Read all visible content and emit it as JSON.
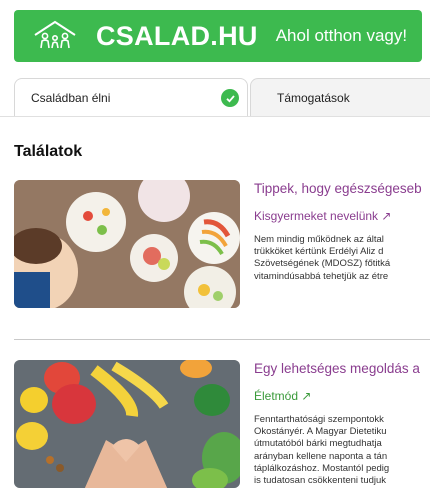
{
  "header": {
    "brand": "CSALAD.HU",
    "tagline": "Ahol otthon vagy!",
    "logo_icon": "family-house-icon",
    "brand_color": "#3dba4f"
  },
  "tabs": [
    {
      "label": "Családban élni",
      "active": true,
      "icon": "check-circle-icon"
    },
    {
      "label": "Támogatások",
      "active": false
    }
  ],
  "results": {
    "heading": "Találatok",
    "items": [
      {
        "title": "Tippek, hogy egészségeseb",
        "category": "Kisgyermeket nevelünk ↗",
        "category_color": "#8a3d8f",
        "excerpt": [
          "Nem mindig működnek az által",
          "trükköket kértünk Erdélyi Aliz d",
          "Szövetségének (MDOSZ) főtitká",
          "vitamindúsabbá tehetjük az étre"
        ]
      },
      {
        "title": "Egy lehetséges megoldás a",
        "category": "Életmód ↗",
        "category_color": "#3a9a3a",
        "excerpt": [
          "Fenntarthatósági szempontokk",
          "Okostányér. A Magyar Dietetiku",
          "útmutatóból bárki megtudhatja",
          "arányban kellene naponta a tán",
          "táplálkozáshoz. Mostantól pedig",
          "is tudatosan csökkenteni tudjuk"
        ]
      }
    ]
  }
}
